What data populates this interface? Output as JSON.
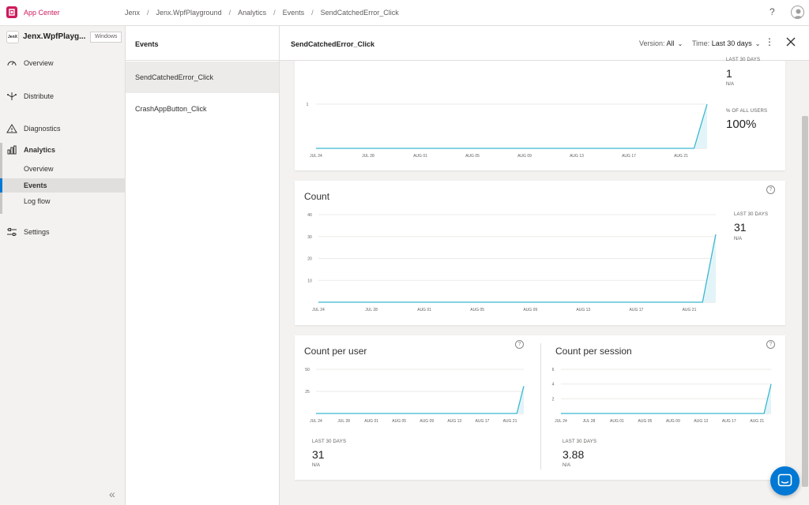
{
  "header": {
    "brand": "App Center",
    "breadcrumbs": [
      "Jenx",
      "Jenx.WpfPlayground",
      "Analytics",
      "Events",
      "SendCatchedError_Click"
    ]
  },
  "sidebar": {
    "app_icon_text": "JenX",
    "app_name": "Jenx.WpfPlayg...",
    "os_badge": "Windows",
    "items": [
      {
        "label": "Overview",
        "icon": "overview-icon"
      },
      {
        "label": "Distribute",
        "icon": "distribute-icon"
      },
      {
        "label": "Diagnostics",
        "icon": "warning-icon"
      },
      {
        "label": "Analytics",
        "icon": "bar-chart-icon"
      },
      {
        "label": "Settings",
        "icon": "settings-sliders-icon"
      }
    ],
    "analytics_sub": [
      "Overview",
      "Events",
      "Log flow"
    ],
    "active_sub": "Events"
  },
  "events": {
    "title": "Events",
    "items": [
      "SendCatchedError_Click",
      "CrashAppButton_Click"
    ],
    "selected": "SendCatchedError_Click"
  },
  "detail": {
    "title": "SendCatchedError_Click",
    "version_label": "Version:",
    "version_value": "All",
    "time_label": "Time:",
    "time_value": "Last 30 days"
  },
  "users_card": {
    "stat_label_partial": "LAST 30 DAYS",
    "stat_value": "1",
    "stat_sub": "N/A",
    "pct_label": "% OF ALL USERS",
    "pct_value": "100%"
  },
  "count_card": {
    "title": "Count",
    "stat_label": "LAST 30 DAYS",
    "stat_value": "31",
    "stat_sub": "N/A"
  },
  "per_user_card": {
    "title": "Count per user",
    "stat_label": "LAST 30 DAYS",
    "stat_value": "31",
    "stat_sub": "N/A"
  },
  "per_session_card": {
    "title": "Count per session",
    "stat_label": "LAST 30 DAYS",
    "stat_value": "3.88",
    "stat_sub": "N/A"
  },
  "colors": {
    "brand": "#cd1b5c",
    "accent": "#0078d4",
    "line": "#3ab8d0",
    "fill": "#e3f4f8"
  },
  "chart_data": [
    {
      "type": "area",
      "x_tick_labels": [
        "JUL 24",
        "JUL 28",
        "AUG 01",
        "AUG 05",
        "AUG 09",
        "AUG 13",
        "AUG 17",
        "AUG 21"
      ],
      "y_tick_labels": [
        "1"
      ],
      "ylim": [
        0,
        1
      ],
      "x": [
        0,
        29,
        30
      ],
      "values": [
        0,
        0,
        1
      ],
      "grid": true
    },
    {
      "type": "area",
      "title": "Count",
      "x_tick_labels": [
        "JUL 24",
        "JUL 28",
        "AUG 01",
        "AUG 05",
        "AUG 09",
        "AUG 13",
        "AUG 17",
        "AUG 21"
      ],
      "y_tick_labels": [
        "10",
        "20",
        "30",
        "40"
      ],
      "ylim": [
        0,
        40
      ],
      "x": [
        0,
        29,
        30
      ],
      "values": [
        0,
        0,
        31
      ],
      "grid": true
    },
    {
      "type": "area",
      "title": "Count per user",
      "x_tick_labels": [
        "JUL 24",
        "JUL 28",
        "AUG 01",
        "AUG 05",
        "AUG 09",
        "AUG 13",
        "AUG 17",
        "AUG 21"
      ],
      "y_tick_labels": [
        "25",
        "50"
      ],
      "ylim": [
        0,
        50
      ],
      "x": [
        0,
        29,
        30
      ],
      "values": [
        0,
        0,
        31
      ],
      "grid": true
    },
    {
      "type": "area",
      "title": "Count per session",
      "x_tick_labels": [
        "JUL 24",
        "JUL 28",
        "AUG 01",
        "AUG 05",
        "AUG 09",
        "AUG 13",
        "AUG 17",
        "AUG 21"
      ],
      "y_tick_labels": [
        "2",
        "4",
        "6"
      ],
      "ylim": [
        0,
        6
      ],
      "x": [
        0,
        29,
        30
      ],
      "values": [
        0,
        0,
        4
      ],
      "grid": true
    }
  ]
}
